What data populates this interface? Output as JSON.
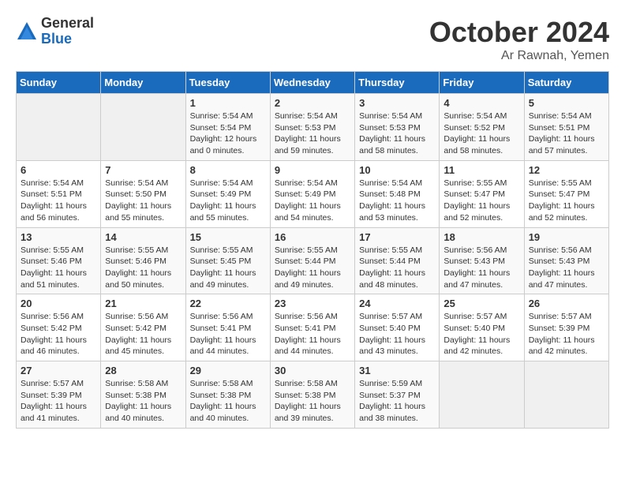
{
  "logo": {
    "general": "General",
    "blue": "Blue"
  },
  "title": "October 2024",
  "subtitle": "Ar Rawnah, Yemen",
  "weekdays": [
    "Sunday",
    "Monday",
    "Tuesday",
    "Wednesday",
    "Thursday",
    "Friday",
    "Saturday"
  ],
  "weeks": [
    [
      {
        "day": "",
        "info": ""
      },
      {
        "day": "",
        "info": ""
      },
      {
        "day": "1",
        "info": "Sunrise: 5:54 AM\nSunset: 5:54 PM\nDaylight: 12 hours\nand 0 minutes."
      },
      {
        "day": "2",
        "info": "Sunrise: 5:54 AM\nSunset: 5:53 PM\nDaylight: 11 hours\nand 59 minutes."
      },
      {
        "day": "3",
        "info": "Sunrise: 5:54 AM\nSunset: 5:53 PM\nDaylight: 11 hours\nand 58 minutes."
      },
      {
        "day": "4",
        "info": "Sunrise: 5:54 AM\nSunset: 5:52 PM\nDaylight: 11 hours\nand 58 minutes."
      },
      {
        "day": "5",
        "info": "Sunrise: 5:54 AM\nSunset: 5:51 PM\nDaylight: 11 hours\nand 57 minutes."
      }
    ],
    [
      {
        "day": "6",
        "info": "Sunrise: 5:54 AM\nSunset: 5:51 PM\nDaylight: 11 hours\nand 56 minutes."
      },
      {
        "day": "7",
        "info": "Sunrise: 5:54 AM\nSunset: 5:50 PM\nDaylight: 11 hours\nand 55 minutes."
      },
      {
        "day": "8",
        "info": "Sunrise: 5:54 AM\nSunset: 5:49 PM\nDaylight: 11 hours\nand 55 minutes."
      },
      {
        "day": "9",
        "info": "Sunrise: 5:54 AM\nSunset: 5:49 PM\nDaylight: 11 hours\nand 54 minutes."
      },
      {
        "day": "10",
        "info": "Sunrise: 5:54 AM\nSunset: 5:48 PM\nDaylight: 11 hours\nand 53 minutes."
      },
      {
        "day": "11",
        "info": "Sunrise: 5:55 AM\nSunset: 5:47 PM\nDaylight: 11 hours\nand 52 minutes."
      },
      {
        "day": "12",
        "info": "Sunrise: 5:55 AM\nSunset: 5:47 PM\nDaylight: 11 hours\nand 52 minutes."
      }
    ],
    [
      {
        "day": "13",
        "info": "Sunrise: 5:55 AM\nSunset: 5:46 PM\nDaylight: 11 hours\nand 51 minutes."
      },
      {
        "day": "14",
        "info": "Sunrise: 5:55 AM\nSunset: 5:46 PM\nDaylight: 11 hours\nand 50 minutes."
      },
      {
        "day": "15",
        "info": "Sunrise: 5:55 AM\nSunset: 5:45 PM\nDaylight: 11 hours\nand 49 minutes."
      },
      {
        "day": "16",
        "info": "Sunrise: 5:55 AM\nSunset: 5:44 PM\nDaylight: 11 hours\nand 49 minutes."
      },
      {
        "day": "17",
        "info": "Sunrise: 5:55 AM\nSunset: 5:44 PM\nDaylight: 11 hours\nand 48 minutes."
      },
      {
        "day": "18",
        "info": "Sunrise: 5:56 AM\nSunset: 5:43 PM\nDaylight: 11 hours\nand 47 minutes."
      },
      {
        "day": "19",
        "info": "Sunrise: 5:56 AM\nSunset: 5:43 PM\nDaylight: 11 hours\nand 47 minutes."
      }
    ],
    [
      {
        "day": "20",
        "info": "Sunrise: 5:56 AM\nSunset: 5:42 PM\nDaylight: 11 hours\nand 46 minutes."
      },
      {
        "day": "21",
        "info": "Sunrise: 5:56 AM\nSunset: 5:42 PM\nDaylight: 11 hours\nand 45 minutes."
      },
      {
        "day": "22",
        "info": "Sunrise: 5:56 AM\nSunset: 5:41 PM\nDaylight: 11 hours\nand 44 minutes."
      },
      {
        "day": "23",
        "info": "Sunrise: 5:56 AM\nSunset: 5:41 PM\nDaylight: 11 hours\nand 44 minutes."
      },
      {
        "day": "24",
        "info": "Sunrise: 5:57 AM\nSunset: 5:40 PM\nDaylight: 11 hours\nand 43 minutes."
      },
      {
        "day": "25",
        "info": "Sunrise: 5:57 AM\nSunset: 5:40 PM\nDaylight: 11 hours\nand 42 minutes."
      },
      {
        "day": "26",
        "info": "Sunrise: 5:57 AM\nSunset: 5:39 PM\nDaylight: 11 hours\nand 42 minutes."
      }
    ],
    [
      {
        "day": "27",
        "info": "Sunrise: 5:57 AM\nSunset: 5:39 PM\nDaylight: 11 hours\nand 41 minutes."
      },
      {
        "day": "28",
        "info": "Sunrise: 5:58 AM\nSunset: 5:38 PM\nDaylight: 11 hours\nand 40 minutes."
      },
      {
        "day": "29",
        "info": "Sunrise: 5:58 AM\nSunset: 5:38 PM\nDaylight: 11 hours\nand 40 minutes."
      },
      {
        "day": "30",
        "info": "Sunrise: 5:58 AM\nSunset: 5:38 PM\nDaylight: 11 hours\nand 39 minutes."
      },
      {
        "day": "31",
        "info": "Sunrise: 5:59 AM\nSunset: 5:37 PM\nDaylight: 11 hours\nand 38 minutes."
      },
      {
        "day": "",
        "info": ""
      },
      {
        "day": "",
        "info": ""
      }
    ]
  ]
}
